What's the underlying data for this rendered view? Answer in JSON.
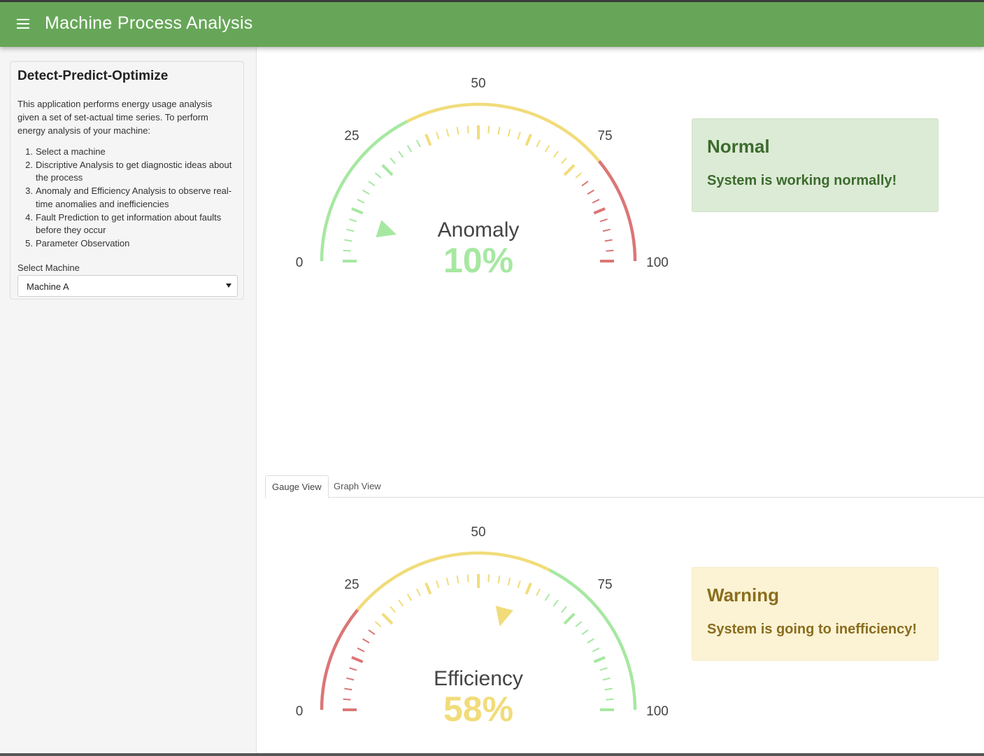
{
  "app": {
    "title": "Machine Process Analysis",
    "menu_icon": "hamburger-menu-icon",
    "header_color": "#67a659"
  },
  "sidebar": {
    "heading": "Detect-Predict-Optimize",
    "description": "This application performs energy usage analysis given a set of set-actual time series. To perform energy analysis of your machine:",
    "steps": [
      {
        "num": "1.",
        "text": "Select a machine"
      },
      {
        "num": "2.",
        "text": "Discriptive Analysis to get diagnostic ideas about the process"
      },
      {
        "num": "3.",
        "text": "Anomaly and Efficiency Analysis to observe real-time anomalies and inefficiencies"
      },
      {
        "num": "4.",
        "text": "Fault Prediction to get information about faults before they occur"
      },
      {
        "num": "5.",
        "text": "Parameter Observation"
      }
    ],
    "select_label": "Select Machine",
    "select_value": "Machine A"
  },
  "gauges": {
    "anomaly": {
      "title": "Anomaly",
      "value": 10,
      "value_text": "10%",
      "scale_labels": [
        "0",
        "25",
        "50",
        "75",
        "100"
      ],
      "value_color": "#a6e8a1",
      "bands": [
        {
          "from": 0,
          "to": 35,
          "color": "#a6e8a1"
        },
        {
          "from": 35,
          "to": 78,
          "color": "#f1dc7a"
        },
        {
          "from": 78,
          "to": 100,
          "color": "#dc7676"
        }
      ]
    },
    "efficiency": {
      "title": "Efficiency",
      "value": 58,
      "value_text": "58%",
      "scale_labels": [
        "0",
        "25",
        "50",
        "75",
        "100"
      ],
      "value_color": "#f1dc7a",
      "bands": [
        {
          "from": 0,
          "to": 22,
          "color": "#dc7676"
        },
        {
          "from": 22,
          "to": 65,
          "color": "#f1dc7a"
        },
        {
          "from": 65,
          "to": 100,
          "color": "#a6e8a1"
        }
      ]
    }
  },
  "alerts": {
    "anomaly": {
      "title": "Normal",
      "message": "System is working normally!"
    },
    "efficiency": {
      "title": "Warning",
      "message": "System is going to inefficiency!"
    }
  },
  "tabs": {
    "gauge_view": "Gauge View",
    "graph_view": "Graph View"
  }
}
